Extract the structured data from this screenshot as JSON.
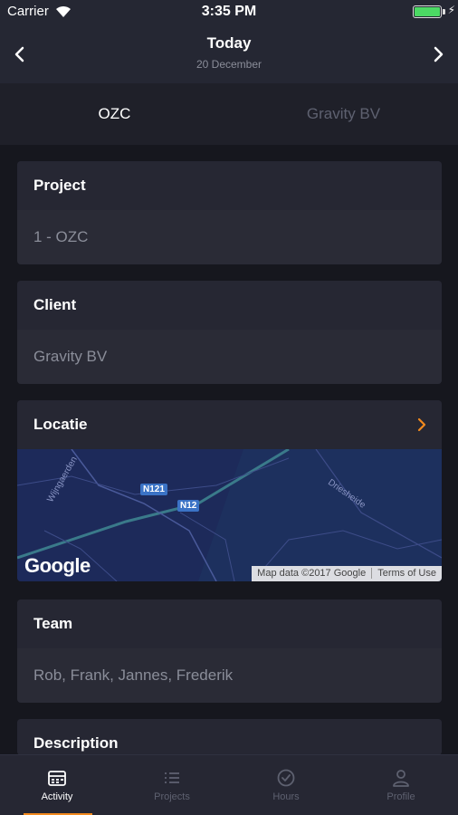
{
  "status": {
    "carrier": "Carrier",
    "time": "3:35 PM"
  },
  "nav": {
    "title": "Today",
    "subtitle": "20 December"
  },
  "segments": [
    "OZC",
    "Gravity BV"
  ],
  "project": {
    "label": "Project",
    "value": "1 - OZC"
  },
  "client": {
    "label": "Client",
    "value": "Gravity BV"
  },
  "location": {
    "label": "Locatie",
    "map": {
      "logo": "Google",
      "attribution": "Map data ©2017 Google",
      "terms": "Terms of Use",
      "roads": [
        "N121",
        "N12"
      ],
      "streets": [
        "Wijngaerden",
        "Driesheide"
      ]
    }
  },
  "team": {
    "label": "Team",
    "value": "Rob, Frank, Jannes, Frederik"
  },
  "description": {
    "label": "Description"
  },
  "tabs": [
    {
      "label": "Activity",
      "icon": "calendar-icon",
      "active": true
    },
    {
      "label": "Projects",
      "icon": "list-icon",
      "active": false
    },
    {
      "label": "Hours",
      "icon": "clock-check-icon",
      "active": false
    },
    {
      "label": "Profile",
      "icon": "person-icon",
      "active": false
    }
  ],
  "colors": {
    "accent": "#f28a1e",
    "background": "#16171e",
    "card": "#262733",
    "battery": "#4cd964"
  }
}
